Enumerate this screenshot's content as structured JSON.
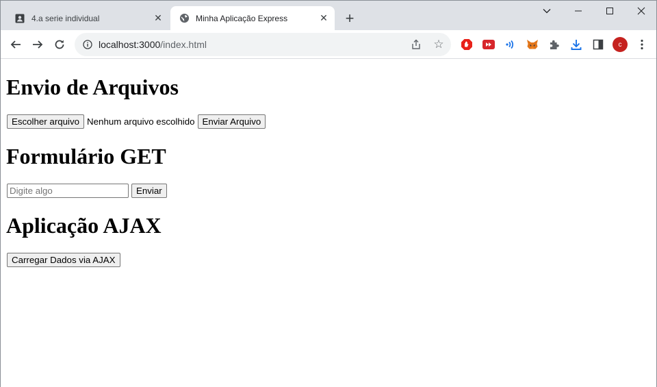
{
  "browser": {
    "tabs": [
      {
        "title": "4.a serie individual",
        "icon": "contact-card-icon",
        "active": false
      },
      {
        "title": "Minha Aplicação Express",
        "icon": "globe-icon",
        "active": true
      }
    ],
    "new_tab_label": "+",
    "address": {
      "host": "localhost:3000",
      "path": "/index.html"
    },
    "avatar_letter": "c",
    "colors": {
      "tabstrip": "#dee1e6",
      "avatar": "#c5221f"
    }
  },
  "page": {
    "upload": {
      "heading": "Envio de Arquivos",
      "choose_label": "Escolher arquivo",
      "no_file_text": "Nenhum arquivo escolhido",
      "submit_label": "Enviar Arquivo"
    },
    "get_form": {
      "heading": "Formulário GET",
      "input_value": "",
      "input_placeholder": "Digite algo",
      "submit_label": "Enviar"
    },
    "ajax": {
      "heading": "Aplicação AJAX",
      "button_label": "Carregar Dados via AJAX"
    }
  }
}
